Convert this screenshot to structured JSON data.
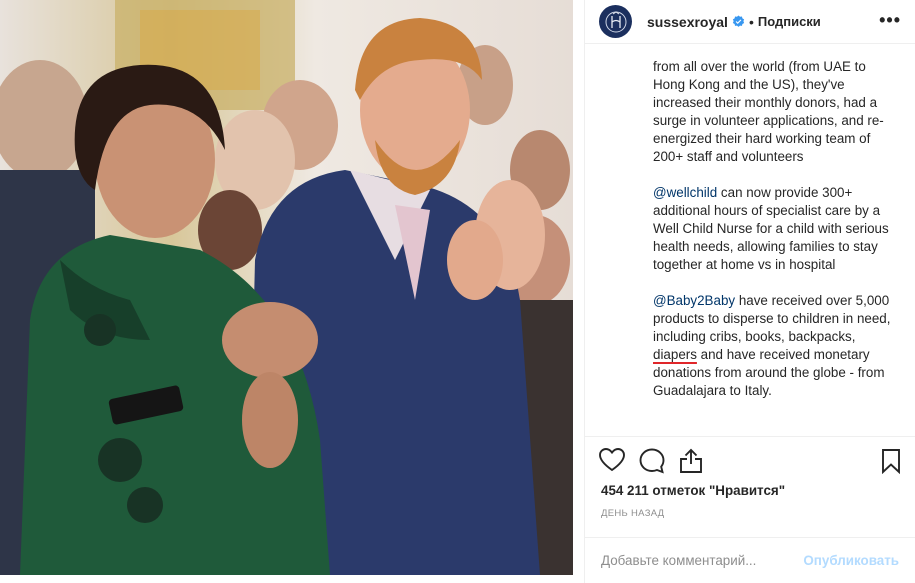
{
  "post": {
    "photo_alt": "",
    "header": {
      "username": "sussexroyal",
      "separator": "•",
      "follow_label": "Подписки",
      "more_label": "•••"
    },
    "caption": {
      "p1": "from all over the world (from UAE to Hong Kong and the US), they've increased their monthly donors, had a surge in volunteer applications, and re-energized their hard working team of 200+ staff and volunteers",
      "p2_mention": "@wellchild",
      "p2_text": " can now provide 300+ additional hours of specialist care by a Well Child Nurse for a child with serious health needs, allowing families to stay together at home vs in hospital",
      "p3_mention": "@Baby2Baby",
      "p3_text_a": " have received over 5,000 products to disperse to children in need, including cribs, books, backpacks, ",
      "p3_highlight": "diapers",
      "p3_text_b": " and have received monetary donations from around the globe - from Guadalajara to Italy."
    },
    "likes_text": "454 211 отметок \"Нравится\"",
    "time_text": "ДЕНЬ НАЗАД",
    "comment": {
      "placeholder": "Добавьте комментарий...",
      "post_label": "Опубликовать"
    },
    "icons": {
      "verified": "verified-badge-icon",
      "like": "heart-icon",
      "comment": "comment-bubble-icon",
      "share": "share-icon",
      "save": "bookmark-icon",
      "more": "more-options-icon"
    },
    "colors": {
      "verified_blue": "#3897f0",
      "mention": "#003569",
      "post_disabled": "#b3dbff",
      "spellcheck_underline": "#e0262a",
      "avatar_bg": "#1b2f5e"
    }
  }
}
